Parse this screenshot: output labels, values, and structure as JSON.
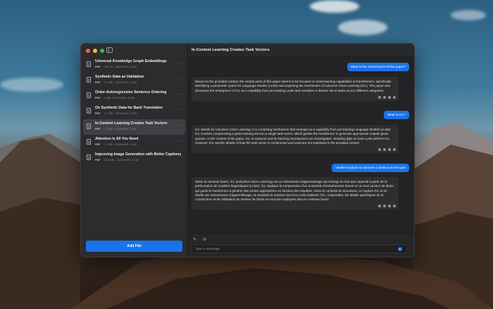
{
  "window": {
    "title": "In-Context Learning Creates Task Vectors"
  },
  "sidebar": {
    "files": [
      {
        "title": "Universal Knowledge Graph Embeddings",
        "type": "PDF",
        "details": "· 758 KB · 2023/09/26, 14:34",
        "active": false
      },
      {
        "title": "Synthetic Data as Validation",
        "type": "PDF",
        "details": "· 3.1 MB · 2023/10/09, 14:28",
        "active": false
      },
      {
        "title": "Order-Autoregressive Sentence Ordering",
        "type": "PDF",
        "details": "· 1 MB · 2023/10/09, 14:29",
        "active": false
      },
      {
        "title": "On Synthetic Data for Back Translation",
        "type": "PDF",
        "details": "· 1.7 MB · 2023/10/09, 14:29",
        "active": false
      },
      {
        "title": "In-Context Learning Creates Task Vectors",
        "type": "PDF",
        "details": "· 1.2 MB · 2023/10/09, 14:31",
        "active": true
      },
      {
        "title": "Attention Is All You Need",
        "type": "PDF",
        "details": "· 2.1 MB · 2023/10/09, 14:33",
        "active": false
      },
      {
        "title": "Improving Image Generation with Better Captions",
        "type": "PDF",
        "details": "· 29.1 MB · 2023/10/09, 17:08",
        "active": false
      }
    ],
    "add_file_label": "Add File"
  },
  "chat": {
    "q1": "What is the central point of this paper?",
    "a1": "Based on the provided context, the central point of this paper seems to be focused on meta-learning capabilities of transformers, specifically identifying a parameter space for Language Models (LLMs) and exploring the mechanism of Inductive Cloze Learning (ICL). The paper also discusses the emergence of ICL as a capability from pre-training LLMs and considers a diverse set of tasks across different categories.",
    "q2": "What is ICL?",
    "a2": "ICL stands for Inductive Cloze Learning. It is a learning mechanism that emerges as a capability from pre-training Language Models (LLMs). ICL involves compressing a given training set into a single task vector, which guides the transformer to generate appropriate outputs given queries. In the context of the paper, ICL is explored and its learning mechanisms are investigated, shedding light on how LLMs perform ICL. However, the specific details of how the task vector is constructed and used are not explained in the provided context",
    "q3": "Veuillez traduire la réponse ci-dessus en français",
    "a3": "Selon le contexte fourni, ICL (Inductive Cloze Learning) est un mécanisme d'apprentissage qui émerge en tant que capacité à partir de la préformation de modèles linguistiques (LLMs). ICL implique la compression d'un ensemble d'entraînement donné en un seul vecteur de tâche, qui guide le transformer à générer des sorties appropriées en fonction des requêtes. Dans le contexte du document, on explore ICL et on étudie ses mécanismes d'apprentissage, en éclairant la manière dont les LLMs réalisent l'ICL. Cependant, les détails spécifiques de la construction et de l'utilisation du vecteur de tâche ne sont pas expliqués dans le contexte fourni."
  },
  "input": {
    "placeholder": "Type a message"
  },
  "icons": {
    "attach": "paperclip-icon",
    "link": "link-icon",
    "send": "send-icon",
    "more": "more-icon",
    "file": "document-icon"
  },
  "colors": {
    "accent": "#1a73e8",
    "window_bg": "#242426",
    "sidebar_bg": "#2c2c2f"
  }
}
